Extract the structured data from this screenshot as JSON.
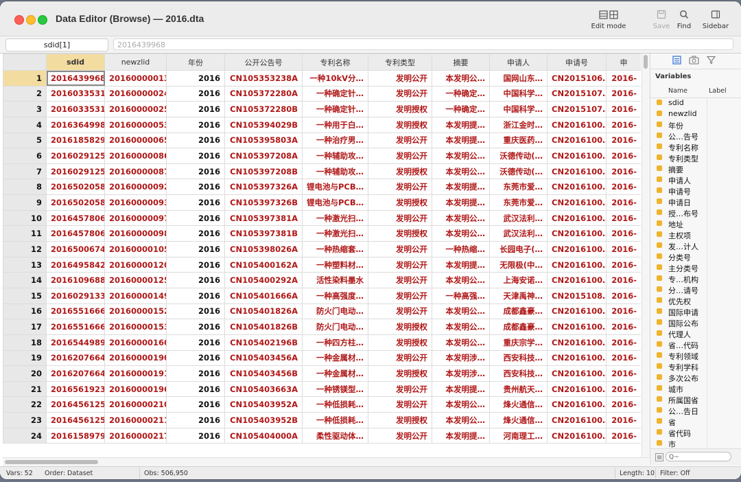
{
  "window": {
    "title": "Data Editor (Browse) — 2016.dta"
  },
  "toolbar": {
    "edit_mode_label": "Edit mode",
    "save_label": "Save",
    "find_label": "Find",
    "sidebar_label": "Sidebar"
  },
  "formula_bar": {
    "cell_ref": "sdid[1]",
    "cell_value": "2016439968"
  },
  "table": {
    "columns": [
      "sdid",
      "newzlid",
      "年份",
      "公开公告号",
      "专利名称",
      "专利类型",
      "摘要",
      "申请人",
      "申请号",
      "申"
    ],
    "selected_column": "sdid",
    "rows": [
      {
        "n": "1",
        "c": [
          "2016439968",
          "20160000013",
          "2016",
          "CN105353238A",
          "一种10kV分…",
          "发明公开",
          "本发明公…",
          "国网山东…",
          "CN2015106…",
          "2016-"
        ]
      },
      {
        "n": "2",
        "c": [
          "2016033531",
          "20160000024",
          "2016",
          "CN105372280A",
          "一种确定针…",
          "发明公开",
          "一种确定…",
          "中国科学…",
          "CN2015107…",
          "2016-"
        ]
      },
      {
        "n": "3",
        "c": [
          "2016033531",
          "20160000025",
          "2016",
          "CN105372280B",
          "一种确定针…",
          "发明授权",
          "一种确定…",
          "中国科学…",
          "CN2015107…",
          "2016-"
        ]
      },
      {
        "n": "4",
        "c": [
          "2016364998",
          "20160000053",
          "2016",
          "CN105394029B",
          "一种用于白…",
          "发明授权",
          "本发明提…",
          "浙江金时…",
          "CN2016100…",
          "2016-"
        ]
      },
      {
        "n": "5",
        "c": [
          "2016185829",
          "20160000065",
          "2016",
          "CN105395803A",
          "一种治疗男…",
          "发明公开",
          "本发明提…",
          "重庆医药…",
          "CN2016100…",
          "2016-"
        ]
      },
      {
        "n": "6",
        "c": [
          "2016029125",
          "20160000086",
          "2016",
          "CN105397208A",
          "一种辅助攻…",
          "发明公开",
          "本发明公…",
          "沃德传动(…",
          "CN2016100…",
          "2016-"
        ]
      },
      {
        "n": "7",
        "c": [
          "2016029125",
          "20160000087",
          "2016",
          "CN105397208B",
          "一种辅助攻…",
          "发明授权",
          "本发明公…",
          "沃德传动(…",
          "CN2016100…",
          "2016-"
        ]
      },
      {
        "n": "8",
        "c": [
          "2016502058",
          "20160000092",
          "2016",
          "CN105397326A",
          "锂电池与PCB…",
          "发明公开",
          "本发明提…",
          "东莞市爱…",
          "CN2016100…",
          "2016-"
        ]
      },
      {
        "n": "9",
        "c": [
          "2016502058",
          "20160000093",
          "2016",
          "CN105397326B",
          "锂电池与PCB…",
          "发明授权",
          "本发明提…",
          "东莞市爱…",
          "CN2016100…",
          "2016-"
        ]
      },
      {
        "n": "10",
        "c": [
          "2016457806",
          "20160000097",
          "2016",
          "CN105397381A",
          "一种激光扫…",
          "发明公开",
          "本发明公…",
          "武汉法利…",
          "CN2016100…",
          "2016-"
        ]
      },
      {
        "n": "11",
        "c": [
          "2016457806",
          "20160000098",
          "2016",
          "CN105397381B",
          "一种激光扫…",
          "发明授权",
          "本发明公…",
          "武汉法利…",
          "CN2016100…",
          "2016-"
        ]
      },
      {
        "n": "12",
        "c": [
          "2016500674",
          "20160000105",
          "2016",
          "CN105398026A",
          "一种热缩套…",
          "发明公开",
          "一种热缩…",
          "长园电子(…",
          "CN2016100…",
          "2016-"
        ]
      },
      {
        "n": "13",
        "c": [
          "2016495842",
          "20160000120",
          "2016",
          "CN105400162A",
          "一种塑料材…",
          "发明公开",
          "本发明提…",
          "无限极(中…",
          "CN2016100…",
          "2016-"
        ]
      },
      {
        "n": "14",
        "c": [
          "2016109688",
          "20160000125",
          "2016",
          "CN105400292A",
          "活性染料墨水",
          "发明公开",
          "本发明公…",
          "上海安诺…",
          "CN2016100…",
          "2016-"
        ]
      },
      {
        "n": "15",
        "c": [
          "2016029133",
          "20160000149",
          "2016",
          "CN105401666A",
          "一种高强度…",
          "发明公开",
          "一种高强…",
          "天津禹神…",
          "CN2015108…",
          "2016-"
        ]
      },
      {
        "n": "16",
        "c": [
          "2016551666",
          "20160000152",
          "2016",
          "CN105401826A",
          "防火门电动…",
          "发明公开",
          "本发明公…",
          "成都鑫豪…",
          "CN2016100…",
          "2016-"
        ]
      },
      {
        "n": "17",
        "c": [
          "2016551666",
          "20160000153",
          "2016",
          "CN105401826B",
          "防火门电动…",
          "发明授权",
          "本发明公…",
          "成都鑫豪…",
          "CN2016100…",
          "2016-"
        ]
      },
      {
        "n": "18",
        "c": [
          "2016544989",
          "20160000160",
          "2016",
          "CN105402196B",
          "一种四方柱…",
          "发明授权",
          "本发明公…",
          "重庆宗学…",
          "CN2016100…",
          "2016-"
        ]
      },
      {
        "n": "19",
        "c": [
          "2016207664",
          "20160000190",
          "2016",
          "CN105403456A",
          "一种金属材…",
          "发明公开",
          "本发明涉…",
          "西安科技…",
          "CN2016100…",
          "2016-"
        ]
      },
      {
        "n": "20",
        "c": [
          "2016207664",
          "20160000191",
          "2016",
          "CN105403456B",
          "一种金属材…",
          "发明授权",
          "本发明涉…",
          "西安科技…",
          "CN2016100…",
          "2016-"
        ]
      },
      {
        "n": "21",
        "c": [
          "2016561923",
          "20160000196",
          "2016",
          "CN105403663A",
          "一种锈镁型…",
          "发明公开",
          "本发明提…",
          "贵州航天…",
          "CN2016100…",
          "2016-"
        ]
      },
      {
        "n": "22",
        "c": [
          "2016456125",
          "20160000210",
          "2016",
          "CN105403952A",
          "一种低损耗…",
          "发明公开",
          "本发明公…",
          "烽火通信…",
          "CN2016100…",
          "2016-"
        ]
      },
      {
        "n": "23",
        "c": [
          "2016456125",
          "20160000211",
          "2016",
          "CN105403952B",
          "一种低损耗…",
          "发明授权",
          "本发明公…",
          "烽火通信…",
          "CN2016100…",
          "2016-"
        ]
      },
      {
        "n": "24",
        "c": [
          "2016158979",
          "20160000217",
          "2016",
          "CN105404000A",
          "柔性驱动体…",
          "发明公开",
          "本发明提…",
          "河南理工…",
          "CN2016100…",
          "2016-"
        ]
      }
    ]
  },
  "sidebar": {
    "title": "Variables",
    "col_name": "Name",
    "col_label": "Label",
    "variables": [
      "sdid",
      "newzlid",
      "年份",
      "公…告号",
      "专利名称",
      "专利类型",
      "摘要",
      "申请人",
      "申请号",
      "申请日",
      "授…布号",
      "地址",
      "主权项",
      "发…计人",
      "分类号",
      "主分类号",
      "专…机构",
      "分…请号",
      "优先权",
      "国际申请",
      "国际公布",
      "代理人",
      "省…代码",
      "专利领域",
      "专利学科",
      "多次公布",
      "城市",
      "所属国省",
      "公…告日",
      "省",
      "省代码",
      "市"
    ],
    "search_placeholder": "Q~"
  },
  "status": {
    "vars": "Vars: 52",
    "order": "Order: Dataset",
    "obs": "Obs: 506,950",
    "length": "Length: 10",
    "filter": "Filter: Off"
  },
  "colors": {
    "string_text": "#b01818",
    "selection": "#f3dca0"
  }
}
